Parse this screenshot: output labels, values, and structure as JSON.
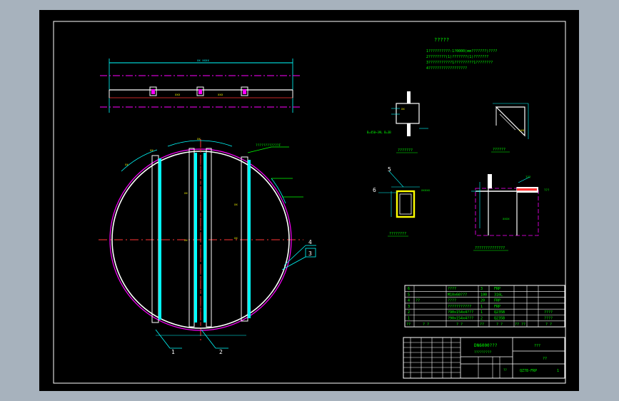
{
  "notes": {
    "title": "?????",
    "lines": [
      "1??????????:1?0000(mm???????)????",
      "2????????(1)???????(1)???????",
      "3???????????1?????????1????????",
      "4??????????????????"
    ]
  },
  "detail_captions": {
    "d1": "???????",
    "d2": "??????",
    "d3": "????????",
    "d4": "??????????????"
  },
  "detail_labels": {
    "d1_left": "B=450~39L B=3B",
    "d3_num5": "5",
    "d3_num6": "6",
    "d4_lbl1": "???",
    "d4_lbl2": "???"
  },
  "plan_labels": {
    "callout_top": "????????????F",
    "balloons": [
      "1",
      "2",
      "3",
      "4"
    ]
  },
  "parts_list": {
    "rows": [
      {
        "no": "6",
        "code": "",
        "name": "????",
        "qty": "3",
        "mat": "FRP",
        "note": ""
      },
      {
        "no": "5",
        "code": "",
        "name": "M10x60???",
        "qty": "100",
        "mat": "316L",
        "note": ""
      },
      {
        "no": "4",
        "code": "??",
        "name": "????",
        "qty": "20",
        "mat": "FRP",
        "note": ""
      },
      {
        "no": "3",
        "code": "",
        "name": "???????????",
        "qty": "1",
        "mat": "FRP",
        "note": ""
      },
      {
        "no": "2",
        "code": "",
        "name": "?90x154x4???",
        "qty": "1",
        "mat": "Q235B",
        "note": "????"
      },
      {
        "no": "1",
        "code": "",
        "name": "?90x154x4???",
        "qty": "2",
        "mat": "Q235B",
        "note": "????"
      }
    ],
    "header": {
      "no": "??",
      "code": "? ?",
      "name": "? ?",
      "qty": "??",
      "mat": "? ?",
      "weight": "?? ??",
      "note": "? ?"
    }
  },
  "title_block": {
    "drawing_name": "DN6000???",
    "drawing_sub": "?????????",
    "drawing_no": "QZ78-FRP",
    "sheet": "1",
    "stage": "???",
    "scale_label": "??",
    "company": "??"
  }
}
